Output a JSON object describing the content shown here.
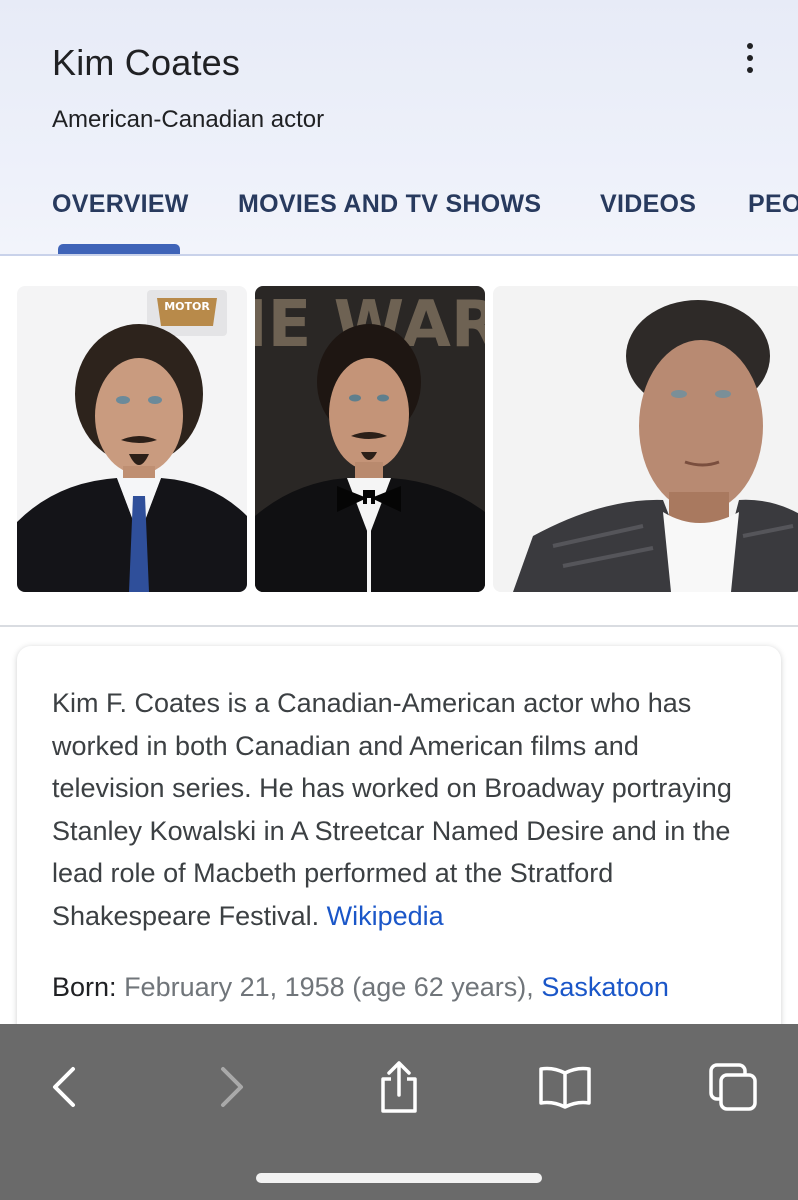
{
  "header": {
    "title": "Kim Coates",
    "subtitle": "American-Canadian actor",
    "more_icon": "more-vertical-icon"
  },
  "tabs": [
    {
      "label": "OVERVIEW",
      "active": true
    },
    {
      "label": "MOVIES AND TV SHOWS",
      "active": false
    },
    {
      "label": "VIDEOS",
      "active": false
    },
    {
      "label": "PEOPLE ALSO SEARCH FOR",
      "active": false
    }
  ],
  "images": [
    {
      "name": "red-carpet-suit-photo",
      "backdrop_text": "MOTOR"
    },
    {
      "name": "awards-tuxedo-photo",
      "backdrop_text": "ENIE WARDS"
    },
    {
      "name": "leather-jacket-portrait-photo"
    }
  ],
  "description": {
    "text": "Kim F. Coates is a Canadian-American actor who has worked in both Canadian and American films and television series. He has worked on Broadway portraying Stanley Kowalski in A Streetcar Named Desire and in the lead role of Macbeth performed at the Stratford Shakespeare Festival.",
    "source_link": "Wikipedia"
  },
  "born": {
    "label": "Born:",
    "value": "February 21, 1958 (age 62 years),",
    "place_link": "Saskatoon"
  },
  "toolbar": {
    "buttons": [
      "back-icon",
      "forward-icon",
      "share-icon",
      "bookmarks-icon",
      "tabs-icon"
    ]
  },
  "colors": {
    "header_bg": "#e7ebf7",
    "tab_text": "#283a5e",
    "tab_indicator": "#3f64b8",
    "link": "#1a56c8",
    "toolbar_bg": "#6a6a6a"
  }
}
